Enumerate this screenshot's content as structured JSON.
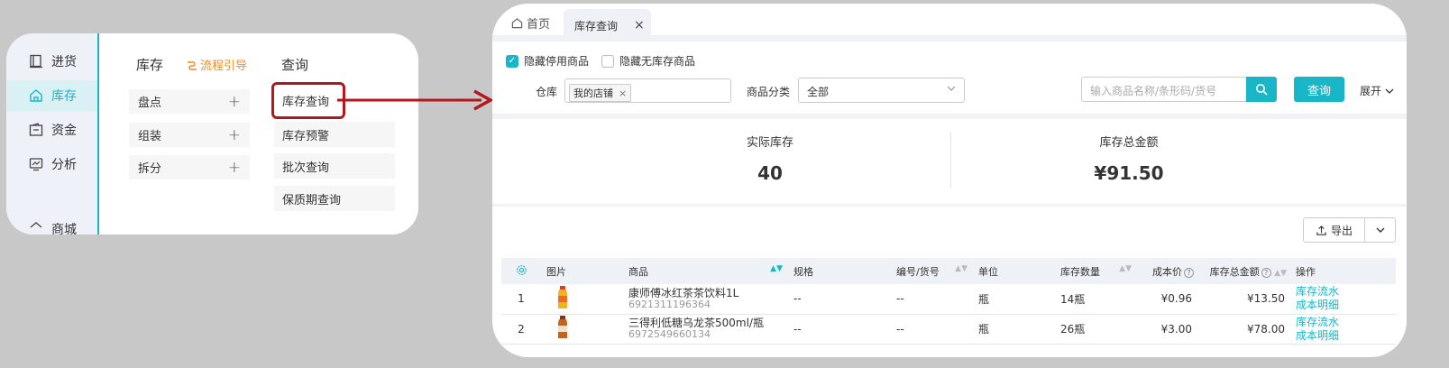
{
  "nav": {
    "items": [
      {
        "label": "进货",
        "icon": "book-icon",
        "active": false
      },
      {
        "label": "库存",
        "icon": "house-icon",
        "active": true
      },
      {
        "label": "资金",
        "icon": "wallet-icon",
        "active": false
      },
      {
        "label": "分析",
        "icon": "chart-icon",
        "active": false
      },
      {
        "label": "商城",
        "icon": "shop-icon",
        "active": false
      }
    ]
  },
  "menu": {
    "stock_heading": "库存",
    "guide_label": "流程引导",
    "query_heading": "查询",
    "stock_items": [
      "盘点",
      "组装",
      "拆分"
    ],
    "plus_symbol": "+",
    "query_items": [
      "库存查询",
      "库存预警",
      "批次查询",
      "保质期查询"
    ]
  },
  "tabs": {
    "home": "首页",
    "active": "库存查询",
    "close": "×"
  },
  "filters": {
    "hide_disabled": "隐藏停用商品",
    "hide_disabled_checked": true,
    "hide_no_stock": "隐藏无库存商品",
    "hide_no_stock_checked": false,
    "warehouse_label": "仓库",
    "warehouse_tag": "我的店铺",
    "category_label": "商品分类",
    "category_value": "全部",
    "search_placeholder": "输入商品名称/条形码/货号",
    "query_button": "查询",
    "expand_label": "展开"
  },
  "summary": {
    "actual_stock_label": "实际库存",
    "actual_stock_value": "40",
    "total_amount_label": "库存总金额",
    "total_amount_value": "¥91.50"
  },
  "export_label": "导出",
  "table": {
    "headers": [
      "图片",
      "商品",
      "规格",
      "编号/货号",
      "单位",
      "库存数量",
      "成本价",
      "库存总金额",
      "操作"
    ],
    "rows": [
      {
        "index": "1",
        "name": "康师傅冰红茶茶饮料1L",
        "code": "6921311196364",
        "spec": "--",
        "sku": "--",
        "unit": "瓶",
        "qty": "14瓶",
        "cost": "¥0.96",
        "total": "¥13.50",
        "op1": "库存流水",
        "op2": "成本明细"
      },
      {
        "index": "2",
        "name": "三得利低糖乌龙茶500ml/瓶",
        "code": "6972549660134",
        "spec": "--",
        "sku": "--",
        "unit": "瓶",
        "qty": "26瓶",
        "cost": "¥3.00",
        "total": "¥78.00",
        "op1": "库存流水",
        "op2": "成本明细"
      }
    ]
  },
  "colors": {
    "accent": "#19b6c8",
    "highlight_border": "#b3161c",
    "guide": "#f08c1e"
  }
}
